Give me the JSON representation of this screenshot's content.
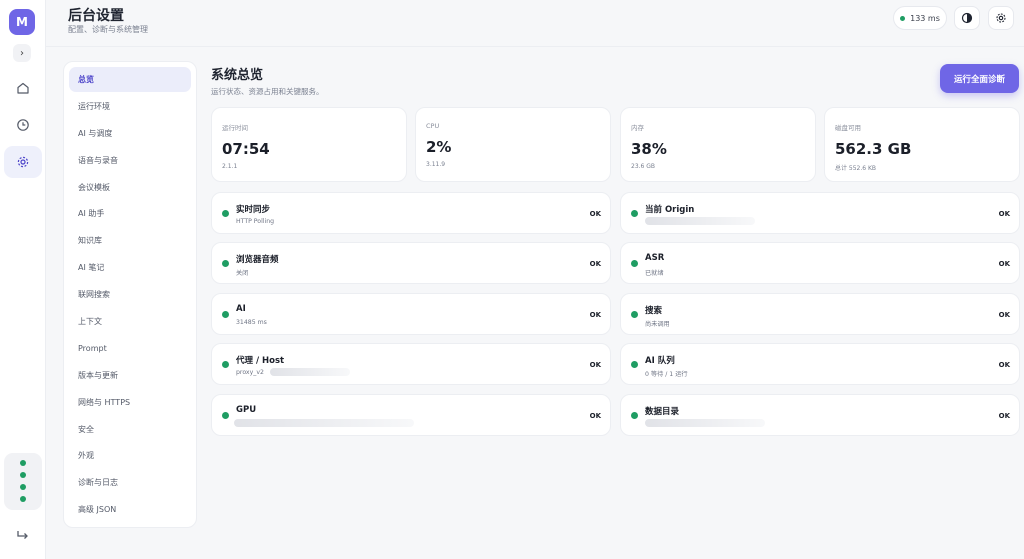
{
  "rail": {
    "logo_letter": "M",
    "toggle_glyph": "›"
  },
  "header": {
    "title": "后台设置",
    "subtitle": "配置、诊断与系统管理",
    "latency": "133 ms"
  },
  "subnav": {
    "items": [
      {
        "label": "总览",
        "active": true
      },
      {
        "label": "运行环境"
      },
      {
        "label": "AI 与调度"
      },
      {
        "label": "语音与录音"
      },
      {
        "label": "会议模板"
      },
      {
        "label": "AI 助手"
      },
      {
        "label": "知识库"
      },
      {
        "label": "AI 笔记"
      },
      {
        "label": "联网搜索"
      },
      {
        "label": "上下文"
      },
      {
        "label": "Prompt"
      },
      {
        "label": "版本与更新"
      },
      {
        "label": "网络与 HTTPS"
      },
      {
        "label": "安全"
      },
      {
        "label": "外观"
      },
      {
        "label": "诊断与日志"
      },
      {
        "label": "高级 JSON"
      }
    ]
  },
  "main": {
    "title": "系统总览",
    "subtitle": "运行状态、资源占用和关键服务。",
    "run_button": "运行全面诊断",
    "stats": [
      {
        "label": "运行时间",
        "value": "07:54",
        "detail": "2.1.1"
      },
      {
        "label": "CPU",
        "value": "2%",
        "detail": "3.11.9"
      },
      {
        "label": "内存",
        "value": "38%",
        "detail": "23.6 GB"
      },
      {
        "label": "磁盘可用",
        "value": "562.3 GB",
        "detail": "总计 552.6 KB"
      }
    ],
    "services": [
      {
        "name": "实时同步",
        "desc": "HTTP Polling",
        "status": "OK"
      },
      {
        "name": "当前 Origin",
        "desc": "",
        "status": "OK"
      },
      {
        "name": "浏览器音频",
        "desc": "关闭",
        "status": "OK"
      },
      {
        "name": "ASR",
        "desc": "已就绪",
        "status": "OK"
      },
      {
        "name": "AI",
        "desc": "31485 ms",
        "status": "OK"
      },
      {
        "name": "搜索",
        "desc": "尚未调用",
        "status": "OK"
      },
      {
        "name": "代理 / Host",
        "desc": "proxy_v2",
        "status": "OK"
      },
      {
        "name": "AI 队列",
        "desc": "0 等待 / 1 运行",
        "status": "OK"
      },
      {
        "name": "GPU",
        "desc": "",
        "status": "OK"
      },
      {
        "name": "数据目录",
        "desc": "",
        "status": "OK"
      }
    ]
  },
  "colors": {
    "accent": "#6f66e6",
    "ok_green": "#1f9d63"
  },
  "icons": [
    "home-icon",
    "clock-icon",
    "gear-icon",
    "logout-icon",
    "contrast-icon",
    "settings-icon"
  ]
}
